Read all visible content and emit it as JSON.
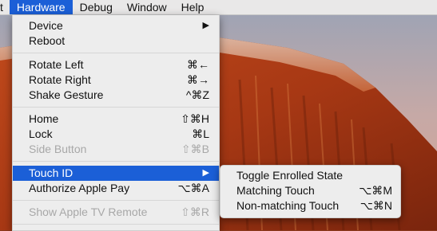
{
  "menubar": {
    "items": [
      {
        "label": "t"
      },
      {
        "label": "Hardware"
      },
      {
        "label": "Debug"
      },
      {
        "label": "Window"
      },
      {
        "label": "Help"
      }
    ]
  },
  "hardware_menu": {
    "device": {
      "label": "Device",
      "arrow": "▶"
    },
    "reboot": {
      "label": "Reboot"
    },
    "rotate_left": {
      "label": "Rotate Left",
      "shortcut": "⌘←"
    },
    "rotate_right": {
      "label": "Rotate Right",
      "shortcut": "⌘→"
    },
    "shake_gesture": {
      "label": "Shake Gesture",
      "shortcut": "^⌘Z"
    },
    "home": {
      "label": "Home",
      "shortcut": "⇧⌘H"
    },
    "lock": {
      "label": "Lock",
      "shortcut": "⌘L"
    },
    "side_button": {
      "label": "Side Button",
      "shortcut": "⇧⌘B"
    },
    "touch_id": {
      "label": "Touch ID",
      "arrow": "▶"
    },
    "authorize_apple_pay": {
      "label": "Authorize Apple Pay",
      "shortcut": "⌥⌘A"
    },
    "show_apple_tv_remote": {
      "label": "Show Apple TV Remote",
      "shortcut": "⇧⌘R"
    }
  },
  "touch_id_submenu": {
    "toggle_enrolled": {
      "label": "Toggle Enrolled State"
    },
    "matching_touch": {
      "label": "Matching Touch",
      "shortcut": "⌥⌘M"
    },
    "non_matching_touch": {
      "label": "Non-matching Touch",
      "shortcut": "⌥⌘N"
    }
  },
  "colors": {
    "highlight": "#1b5fd7",
    "menu_bg": "#ededed",
    "disabled_text": "#a8a8a8"
  }
}
